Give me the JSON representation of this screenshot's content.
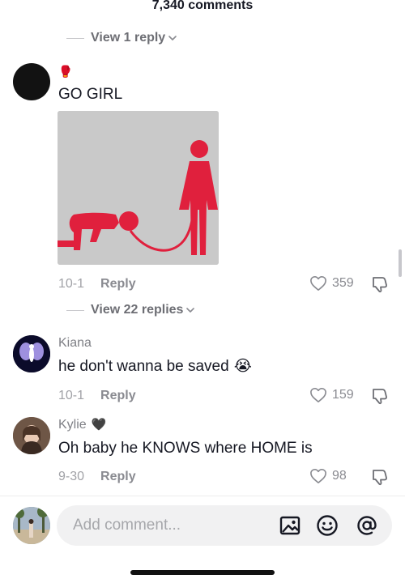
{
  "header": {
    "comment_count": "7,340 comments"
  },
  "thread_top": {
    "view_replies_label": "View 1 reply"
  },
  "comments": [
    {
      "username_emoji": "🥊",
      "text": "GO GIRL",
      "date": "10-1",
      "reply_label": "Reply",
      "likes": "359",
      "view_replies_label": "View 22 replies"
    },
    {
      "username": "Kiana",
      "text": "he don't wanna be saved",
      "text_emoji": "😭",
      "date": "10-1",
      "reply_label": "Reply",
      "likes": "159"
    },
    {
      "username": "Kylie",
      "username_emoji": "🖤",
      "text": "Oh baby he KNOWS where HOME is",
      "date": "9-30",
      "reply_label": "Reply",
      "likes": "98"
    }
  ],
  "composer": {
    "placeholder": "Add comment...",
    "value": ""
  },
  "colors": {
    "accent_red": "#e0203d",
    "media_bg": "#c9c9c9"
  },
  "icons": [
    "chevron-down-icon",
    "heart-icon",
    "dislike-icon",
    "image-icon",
    "emoji-icon",
    "mention-icon"
  ]
}
